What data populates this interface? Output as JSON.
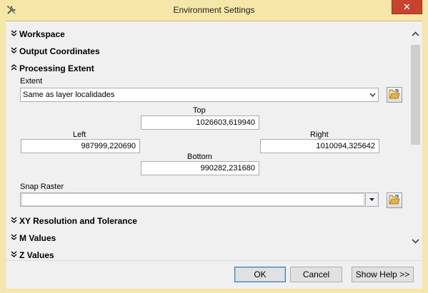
{
  "window": {
    "title": "Environment Settings",
    "close_symbol": "✕"
  },
  "sections": {
    "workspace": "Workspace",
    "output_coordinates": "Output Coordinates",
    "processing_extent": "Processing Extent",
    "xy_resolution": "XY Resolution and Tolerance",
    "m_values": "M Values",
    "z_values": "Z Values"
  },
  "extent": {
    "label": "Extent",
    "selected": "Same as layer localidades",
    "top_label": "Top",
    "top_value": "1026603,619940",
    "left_label": "Left",
    "left_value": "987999,220690",
    "right_label": "Right",
    "right_value": "1010094,325642",
    "bottom_label": "Bottom",
    "bottom_value": "990282,231680"
  },
  "snap_raster": {
    "label": "Snap Raster",
    "value": ""
  },
  "buttons": {
    "ok": "OK",
    "cancel": "Cancel",
    "show_help": "Show Help >>"
  },
  "icons": {
    "expand": "chevron-double-down-icon",
    "collapse": "chevron-double-up-icon",
    "browse": "open-folder-icon",
    "app": "tools-icon"
  }
}
